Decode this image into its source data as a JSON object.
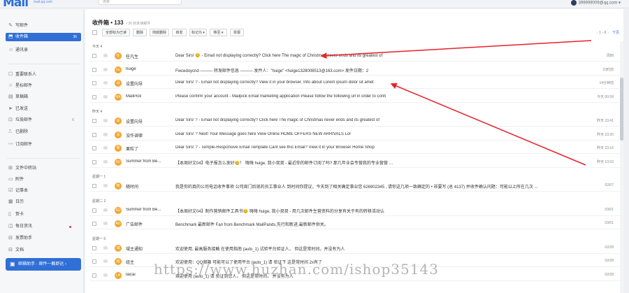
{
  "topbar": {
    "logo": "Mail",
    "logo_sub": "mail.qq.com",
    "search_placeholder": "搜索",
    "user_email": "399999009@qq.com ▾"
  },
  "sidebar": {
    "items": [
      {
        "name": "write",
        "icon": "pencil-icon",
        "glyph": "✎",
        "label": "写邮件",
        "count": ""
      },
      {
        "name": "inbox",
        "icon": "inbox-icon",
        "glyph": "⬒",
        "label": "收件箱",
        "count": "36"
      },
      {
        "name": "contacts",
        "icon": "contacts-icon",
        "glyph": "☺",
        "label": "通讯录",
        "count": ""
      },
      {
        "name": "vip",
        "icon": "star-contact-icon",
        "glyph": "☐",
        "label": "重要联系人",
        "count": ""
      },
      {
        "name": "starred",
        "icon": "star-icon",
        "glyph": "☆",
        "label": "星标邮件",
        "count": ""
      },
      {
        "name": "drafts",
        "icon": "draft-icon",
        "glyph": "▤",
        "label": "草稿箱",
        "count": ""
      },
      {
        "name": "sent",
        "icon": "sent-icon",
        "glyph": "➤",
        "label": "已发送",
        "count": ""
      },
      {
        "name": "spam",
        "icon": "spam-icon",
        "glyph": "⊡",
        "label": "垃圾邮件",
        "count": "6"
      },
      {
        "name": "deleted",
        "icon": "trash-icon",
        "glyph": "⎍",
        "label": "已删除",
        "count": ""
      },
      {
        "name": "subscribe",
        "icon": "rss-icon",
        "glyph": "〰",
        "label": "订阅邮件",
        "count": ""
      },
      {
        "name": "filecenter",
        "icon": "file-center-icon",
        "glyph": "⊞",
        "label": "文件中转站",
        "count": ""
      },
      {
        "name": "files",
        "icon": "file-icon",
        "glyph": "▭",
        "label": "附件",
        "count": ""
      },
      {
        "name": "notes",
        "icon": "note-icon",
        "glyph": "☑",
        "label": "记事本",
        "count": ""
      },
      {
        "name": "calendar",
        "icon": "calendar-icon",
        "glyph": "▦",
        "label": "日历",
        "count": ""
      },
      {
        "name": "cards",
        "icon": "card-icon",
        "glyph": "▯",
        "label": "贺卡",
        "count": ""
      },
      {
        "name": "daily",
        "icon": "daily-icon",
        "glyph": "◫",
        "label": "每日资讯",
        "count": ""
      },
      {
        "name": "translator",
        "icon": "translate-icon",
        "glyph": "⊟",
        "label": "发票助手",
        "count": ""
      },
      {
        "name": "docs",
        "icon": "doc-icon",
        "glyph": "⊟",
        "label": "文档",
        "count": ""
      }
    ],
    "helper_button": "邮箱助手 · 邮件一触即达 ›"
  },
  "main": {
    "title": "收件箱 • 133",
    "subtitle": "/  36 封未读邮件",
    "toolbar": [
      "全部标为已读",
      "删除",
      "彻底删除",
      "转发",
      "标记为 ▾",
      "移至 ▾",
      "举报"
    ],
    "pager": {
      "text": "1 - 6",
      "prev": "‹",
      "next_arrow": "›",
      "next": "下页"
    },
    "groups": [
      {
        "label": "今天 4",
        "rows": [
          {
            "sender": "任凡生",
            "avatar": "任",
            "avatar_color": "#f2a52e",
            "subject": "Dear Sirs! 😊 - Email not displaying correctly? Click here The magic of Christmas never ends and its greatest of",
            "time": "周四"
          },
          {
            "sender": "huige",
            "avatar": "hu",
            "avatar_color": "#f2a52e",
            "subject": "Fwcedoycnd  ——— 转发邮件信息 ———  发件人：\"huige\" <huige1328008513@163.com> 发件日期：2",
            "time": "23时前"
          },
          {
            "sender": "设置向导",
            "avatar": "设",
            "avatar_color": "#f2a52e",
            "subject": "Dear Sirs! ? - Email not displaying correctly? View it in your browser. Info about Lorem ipsum dolor sit amet",
            "time": "14分钟前"
          },
          {
            "sender": "MailPick",
            "avatar": "MA",
            "avatar_color": "#f2a52e",
            "subject": "Please confirm your account  - Mailpick Email marketing application  Please follow the following url in order to confi",
            "time": "今天 00:58"
          }
        ]
      },
      {
        "label": "昨天 4",
        "rows": [
          {
            "sender": "设置向导",
            "avatar": "设",
            "avatar_color": "#f2a52e",
            "subject": "Dear Sirs! ? - Email not displaying correctly? Click here The magic of Christmas never ends and its greatest of",
            "time": "昨天 23:41"
          },
          {
            "sender": "没作调律",
            "avatar": "没",
            "avatar_color": "#f2a52e",
            "subject": "Dear Sirs! ?  Next! Your Message goes here View Online HOME OFFERS NEW ARRIVALS Lor",
            "time": "昨天 23:20"
          },
          {
            "sender": "果粒了",
            "avatar": "果",
            "avatar_color": "#f2a52e",
            "subject": "Dear Sirs! ? - Temple-Responsive Email Template Cant see this Email? View it in your Browser Home Shop",
            "time": "昨天 23:16"
          },
          {
            "sender": "Summer from Be...",
            "avatar": "SU",
            "avatar_color": "#f2a52e",
            "subject": "【本周好文04】电子报怎么发好😊！ 嗨嗨 huige, 我小叔叔 - 最近你的邮件订阅了吗? 那几年业会专营我的专业营营 …",
            "time": "昨天 13:53"
          }
        ]
      },
      {
        "label": "星期一 1",
        "rows": [
          {
            "sender": "随时间",
            "avatar": "随",
            "avatar_color": "#f2a52e",
            "subject": "我是你的真的公司电话收件事项 公司周门后现的员工事业人  到时间你提议，今天到了相关确定事业您   626902345   , 请你这几项一致确定的  • 非要写 (总 4137) 并收件确认问题：可能以上所在几次 ...",
            "time": "02/07"
          }
        ]
      },
      {
        "label": "星期二 2",
        "rows": [
          {
            "sender": "Summer from Be...",
            "avatar": "SU",
            "avatar_color": "#f2a52e",
            "subject": "【本周好文04】制作营销邮件工具书😊  嗨嗨 huige, 我小叔叔 - 用几次邮件生营资料的分享有关于有的转移活动认",
            "time": "03/01"
          },
          {
            "sender": "广告邮件",
            "avatar": "AD",
            "avatar_color": "#f2a52e",
            "subject": "Benchmark 最新邮件 Fan from Benchmark MailPands,先行和新进,最新邮件供关。",
            "time": "03/01"
          }
        ]
      },
      {
        "label": "星期一 5",
        "rows": [
          {
            "sender": "域主通知",
            "avatar": "域",
            "avatar_color": "#f2a52e",
            "subject": "欢迎使用, 最高服务接触 在使用指南 (auto_1)           试验平台验证人，  但这是常时间，并没有为人",
            "time": "02/28"
          },
          {
            "sender": "组主",
            "avatar": "组",
            "avatar_color": "#f2a52e",
            "subject": "欢迎使用：QQ邮箱 可能可以了使用平台 (auto_1)       请 验证下 这是常时间 2x有了",
            "time": "02/28"
          },
          {
            "sender": "laicai",
            "avatar": "LA",
            "avatar_color": "#f2a52e",
            "subject": "欢迎使用 (auto_1)              请 验证到您人，  但这是常时间，  并没有为人",
            "time": "02/28"
          }
        ]
      }
    ]
  },
  "watermark": "https://www.huzhan.com/ishop35143"
}
